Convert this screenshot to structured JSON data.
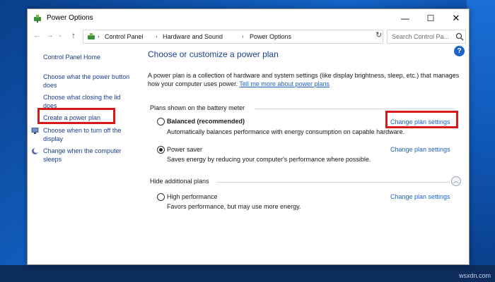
{
  "window": {
    "title": "Power Options",
    "minimize_glyph": "—",
    "maximize_glyph": "☐",
    "close_glyph": "✕"
  },
  "nav": {
    "back_glyph": "←",
    "forward_glyph": "→",
    "recent_glyph": "⌄",
    "up_glyph": "↑"
  },
  "address": {
    "crumbs": [
      "Control Panel",
      "Hardware and Sound",
      "Power Options"
    ],
    "separator": "›",
    "dropdown_glyph": "⌄",
    "refresh_glyph": "↻"
  },
  "search": {
    "placeholder": "Search Control Pa..."
  },
  "help": {
    "glyph": "?"
  },
  "sidebar": {
    "home": "Control Panel Home",
    "items": [
      {
        "line1": "Choose what the power button",
        "line2": "does"
      },
      {
        "line1": "Choose what closing the lid",
        "line2": "does"
      },
      {
        "line1": "Create a power plan"
      },
      {
        "line1": "Choose when to turn off the",
        "line2": "display"
      },
      {
        "line1": "Change when the computer",
        "line2": "sleeps"
      }
    ]
  },
  "main": {
    "heading": "Choose or customize a power plan",
    "intro_line1": "A power plan is a collection of hardware and system settings (like display brightness, sleep, etc.) that manages",
    "intro_line2_prefix": "how your computer uses power. ",
    "intro_link": "Tell me more about power plans",
    "battery_section": "Plans shown on the battery meter",
    "hidden_section": "Hide additional plans",
    "collapse_glyph": "︿",
    "plans": [
      {
        "name": "Balanced (recommended)",
        "description": "Automatically balances performance with energy consumption on capable hardware.",
        "link": "Change plan settings",
        "selected": false
      },
      {
        "name": "Power saver",
        "description": "Saves energy by reducing your computer's performance where possible.",
        "link": "Change plan settings",
        "selected": true
      },
      {
        "name": "High performance",
        "description": "Favors performance, but may use more energy.",
        "link": "Change plan settings",
        "selected": false
      }
    ]
  },
  "watermark": "wsxdn.com",
  "colors": {
    "link": "#1d63c6",
    "highlight": "#d61a1a",
    "desktop": "#1463c8"
  }
}
